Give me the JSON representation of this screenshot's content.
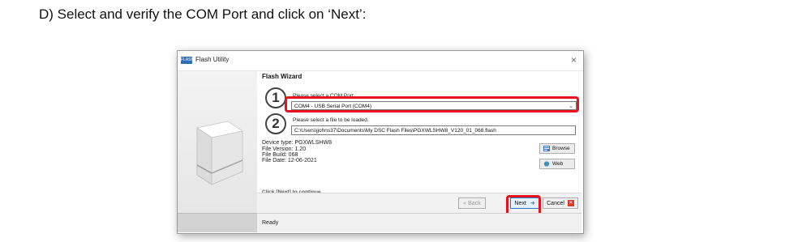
{
  "instruction": "D) Select and verify the COM Port and click on ‘Next’:",
  "window": {
    "title": "Flash Utility",
    "app_icon_label": "FLASH",
    "close_glyph": "×"
  },
  "wizard": {
    "title": "Flash Wizard",
    "step1": {
      "number": "1",
      "label": "Please select a COM Port",
      "selected_port": "COM4 - USB Serial Port (COM4)"
    },
    "step2": {
      "number": "2",
      "label": "Please select a file to be loaded.",
      "file_path": "C:\\Users\\jjohns37\\Documents\\My DSC Flash Files\\PGXWLSHW8_V120_01_068.flash"
    },
    "device_info": {
      "device_type": "Device type: PGXWLSHW8",
      "file_version": "File Version: 1.20",
      "file_build": "File Build: 068",
      "file_date": "File Date: 12-06-2021"
    },
    "browse_label": "Browse",
    "web_label": "Web",
    "hint": "Click [Next] to continue"
  },
  "buttons": {
    "back": "« Back",
    "next": "Next",
    "next_arrow": "➜",
    "cancel": "Cancel"
  },
  "status": "Ready",
  "colors": {
    "highlight": "#e8121f",
    "accent": "#2a74c7"
  }
}
